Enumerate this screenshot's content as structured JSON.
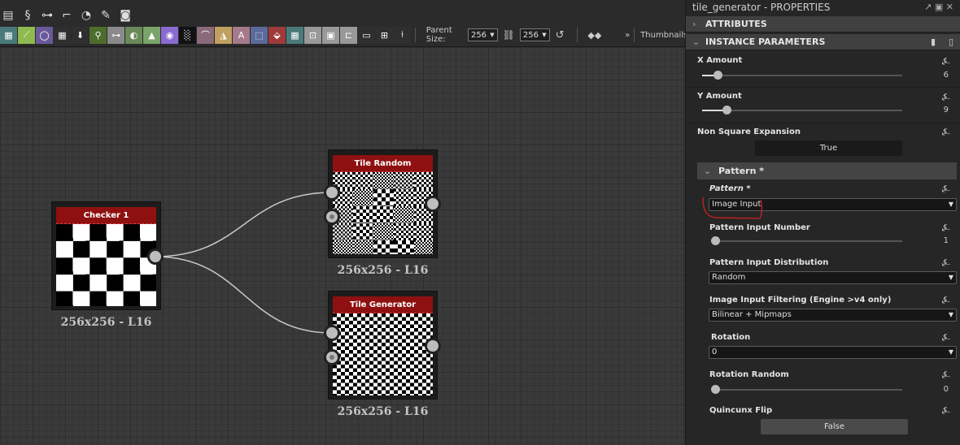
{
  "toolbar": {
    "row1_icons": [
      "layout-icon",
      "python-icon",
      "connector-icon",
      "path-icon",
      "timer-icon",
      "wrench-icon",
      "screenshot-icon"
    ],
    "row2_icons": [
      {
        "name": "map-icon",
        "color": "#4a7a7a"
      },
      {
        "name": "gradient-icon",
        "color": "#8fba50"
      },
      {
        "name": "circle-icon",
        "color": "#6a5a9a"
      },
      {
        "name": "grid-icon",
        "color": "#2f2f2f"
      },
      {
        "name": "import-icon",
        "color": "#2f2f2f"
      },
      {
        "name": "tag-icon",
        "color": "#4d6d2d"
      },
      {
        "name": "link-icon",
        "color": "#8a8a8a"
      },
      {
        "name": "blend-icon",
        "color": "#6a8a5a"
      },
      {
        "name": "levels-icon",
        "color": "#7aa56a"
      },
      {
        "name": "color-wheel-icon",
        "color": "#8a6ad0"
      },
      {
        "name": "noise-icon",
        "color": "#111111"
      },
      {
        "name": "curve-icon",
        "color": "#8a6a7a"
      },
      {
        "name": "warning-icon",
        "color": "#c0a060"
      },
      {
        "name": "text-icon",
        "color": "#a57a8a"
      },
      {
        "name": "transform-icon",
        "color": "#5a6a9a"
      },
      {
        "name": "fill-icon",
        "color": "#a03a3a"
      },
      {
        "name": "map-icon",
        "color": "#4a7a7a"
      },
      {
        "name": "input-icon",
        "color": "#999999"
      },
      {
        "name": "gradient-input-icon",
        "color": "#999999"
      },
      {
        "name": "output-icon",
        "color": "#999999"
      },
      {
        "name": "comment-icon",
        "color": "#2f2f2f"
      },
      {
        "name": "graph-icon",
        "color": "#2f2f2f"
      },
      {
        "name": "pin-icon",
        "color": "#2f2f2f"
      }
    ],
    "parent_size_label": "Parent Size:",
    "parent_size_w": "256",
    "parent_size_h": "256",
    "thumbnails_label": "Thumbnails:"
  },
  "nodes": [
    {
      "title": "Checker 1",
      "info": "256x256 - L16"
    },
    {
      "title": "Tile Random",
      "info": "256x256 - L16"
    },
    {
      "title": "Tile Generator",
      "info": "256x256 - L16"
    }
  ],
  "panel": {
    "title": "tile_generator - PROPERTIES",
    "attributes": "ATTRIBUTES",
    "instance_parameters": "INSTANCE PARAMETERS",
    "x_amount": {
      "label": "X Amount",
      "value": "6",
      "fraction": 0.08
    },
    "y_amount": {
      "label": "Y Amount",
      "value": "9",
      "fraction": 0.13
    },
    "non_square": {
      "label": "Non Square Expansion",
      "value": "True"
    },
    "pattern_group": "Pattern *",
    "pattern": {
      "label": "Pattern *",
      "value": "Image Input"
    },
    "pattern_input_number": {
      "label": "Pattern Input Number",
      "value": "1",
      "fraction": 0.0
    },
    "distribution": {
      "label": "Pattern Input Distribution",
      "value": "Random"
    },
    "filtering": {
      "label": "Image Input Filtering (Engine >v4 only)",
      "value": "Bilinear + Mipmaps"
    },
    "rotation": {
      "label": "Rotation",
      "value": "0"
    },
    "rotation_random": {
      "label": "Rotation Random",
      "value": "0",
      "fraction": 0.0
    },
    "quincunx": {
      "label": "Quincunx Flip",
      "value": "False"
    }
  },
  "colors": {
    "node_header": "#8e1010",
    "annotation": "#d02020"
  }
}
